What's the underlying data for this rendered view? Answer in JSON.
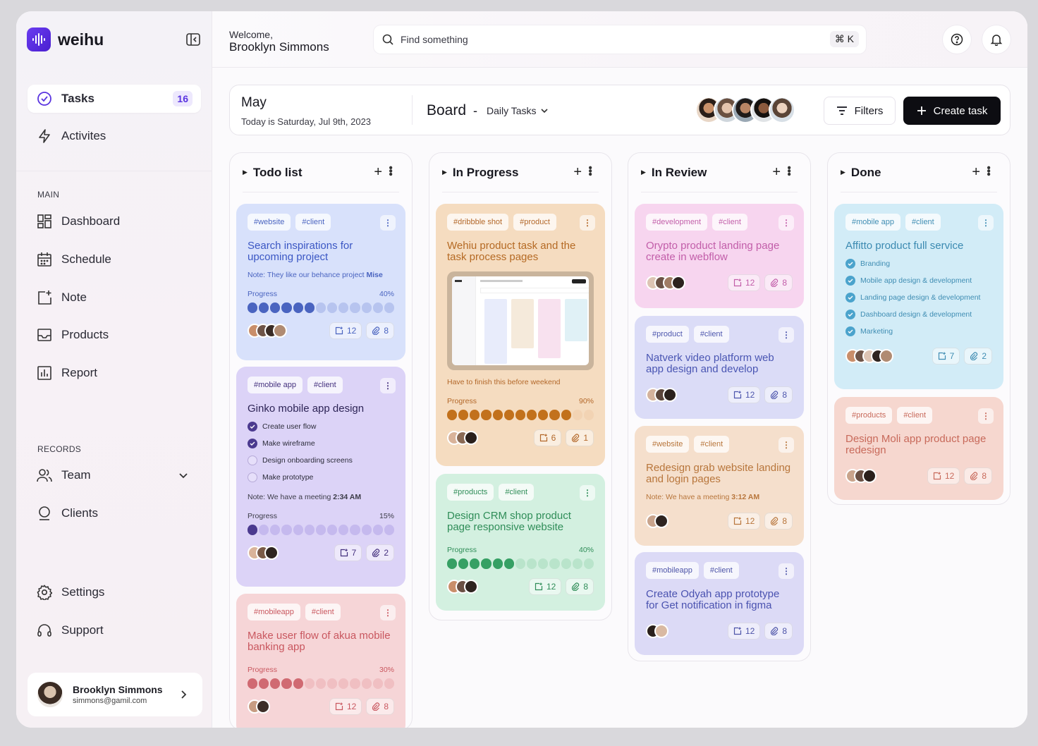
{
  "app": {
    "name": "weihu"
  },
  "sidebar": {
    "primary": [
      {
        "label": "Tasks",
        "badge": "16"
      },
      {
        "label": "Activites"
      }
    ],
    "main_heading": "MAIN",
    "main": [
      {
        "label": "Dashboard"
      },
      {
        "label": "Schedule"
      },
      {
        "label": "Note"
      },
      {
        "label": "Products"
      },
      {
        "label": "Report"
      }
    ],
    "records_heading": "RECORDS",
    "records": [
      {
        "label": "Team"
      },
      {
        "label": "Clients"
      }
    ],
    "bottom": [
      {
        "label": "Settings"
      },
      {
        "label": "Support"
      }
    ],
    "user": {
      "name": "Brooklyn Simmons",
      "email": "simmons@gamil.com"
    }
  },
  "header": {
    "welcome": "Welcome,",
    "user": "Brooklyn Simmons",
    "search_placeholder": "Find something",
    "shortcut": "⌘ K"
  },
  "boardbar": {
    "month": "May",
    "today": "Today is Saturday, Jul 9th, 2023",
    "title": "Board",
    "dash": "-",
    "view": "Daily Tasks",
    "filters": "Filters",
    "create": "Create task"
  },
  "columns": [
    {
      "title": "Todo list",
      "cards": [
        {
          "tags": [
            "#website",
            "#client"
          ],
          "title": "Search inspirations for upcoming project",
          "note_label": "Note:",
          "note": "They like our behance project",
          "note_bold": "Mise",
          "progress_label": "Progress",
          "progress": "40%",
          "subtasks": "12",
          "attachments": "8"
        },
        {
          "tags": [
            "#mobile app",
            "#client"
          ],
          "title": "Ginko mobile app design",
          "checklist": [
            {
              "text": "Create user flow",
              "done": true
            },
            {
              "text": "Make wireframe",
              "done": true
            },
            {
              "text": "Design onboarding screens",
              "done": false
            },
            {
              "text": "Make prototype",
              "done": false
            }
          ],
          "note_label": "Note:",
          "note": "We have a meeting",
          "note_bold": "2:34 AM",
          "progress_label": "Progress",
          "progress": "15%",
          "subtasks": "7",
          "attachments": "2"
        },
        {
          "tags": [
            "#mobileapp",
            "#client"
          ],
          "title": "Make user flow of akua mobile banking app",
          "progress_label": "Progress",
          "progress": "30%",
          "subtasks": "12",
          "attachments": "8"
        }
      ]
    },
    {
      "title": "In Progress",
      "cards": [
        {
          "tags": [
            "#dribbble shot",
            "#product"
          ],
          "title": "Wehiu product task and the task process pages",
          "caption": "Have to finish this before weekend",
          "progress_label": "Progress",
          "progress": "90%",
          "subtasks": "6",
          "attachments": "1"
        },
        {
          "tags": [
            "#products",
            "#client"
          ],
          "title": "Design CRM shop product page responsive website",
          "progress_label": "Progress",
          "progress": "40%",
          "subtasks": "12",
          "attachments": "8"
        }
      ]
    },
    {
      "title": "In Review",
      "cards": [
        {
          "tags": [
            "#development",
            "#client"
          ],
          "title": "Orypto product landing  page create in webflow",
          "subtasks": "12",
          "attachments": "8"
        },
        {
          "tags": [
            "#product",
            "#client"
          ],
          "title": "Natverk video platform web app design and develop",
          "subtasks": "12",
          "attachments": "8"
        },
        {
          "tags": [
            "#website",
            "#client"
          ],
          "title": "Redesign grab website landing and login pages",
          "note_label": "Note:",
          "note": "We have a meeting",
          "note_bold": "3:12 AM",
          "subtasks": "12",
          "attachments": "8"
        },
        {
          "tags": [
            "#mobileapp",
            "#client"
          ],
          "title": "Create Odyah app prototype for Get notification in figma",
          "subtasks": "12",
          "attachments": "8"
        }
      ]
    },
    {
      "title": "Done",
      "cards": [
        {
          "tags": [
            "#mobile app",
            "#client"
          ],
          "title": "Affitto product full service",
          "checklist": [
            {
              "text": "Branding",
              "done": true
            },
            {
              "text": "Mobile app design & development",
              "done": true
            },
            {
              "text": "Landing page design & development",
              "done": true
            },
            {
              "text": "Dashboard design & development",
              "done": true
            },
            {
              "text": "Marketing",
              "done": true
            }
          ],
          "subtasks": "7",
          "attachments": "2"
        },
        {
          "tags": [
            "#products",
            "#client"
          ],
          "title": "Design Moli app product page redesign",
          "subtasks": "12",
          "attachments": "8"
        }
      ]
    }
  ],
  "colors": {
    "accent": "#5a34e0",
    "blue": "#4a64c0",
    "violet": "#4b3a8f",
    "rose": "#d06a72",
    "orange": "#c2711c",
    "mint": "#36a064"
  },
  "icons": [
    "tasks-icon",
    "bolt-icon",
    "dashboard-icon",
    "calendar-icon",
    "note-icon",
    "inbox-icon",
    "report-icon",
    "team-icon",
    "clients-icon",
    "gear-icon",
    "headset-icon",
    "search-icon",
    "help-icon",
    "bell-icon",
    "filter-icon",
    "plus-icon",
    "sidebar-collapse-icon",
    "subtask-icon",
    "paperclip-icon"
  ]
}
